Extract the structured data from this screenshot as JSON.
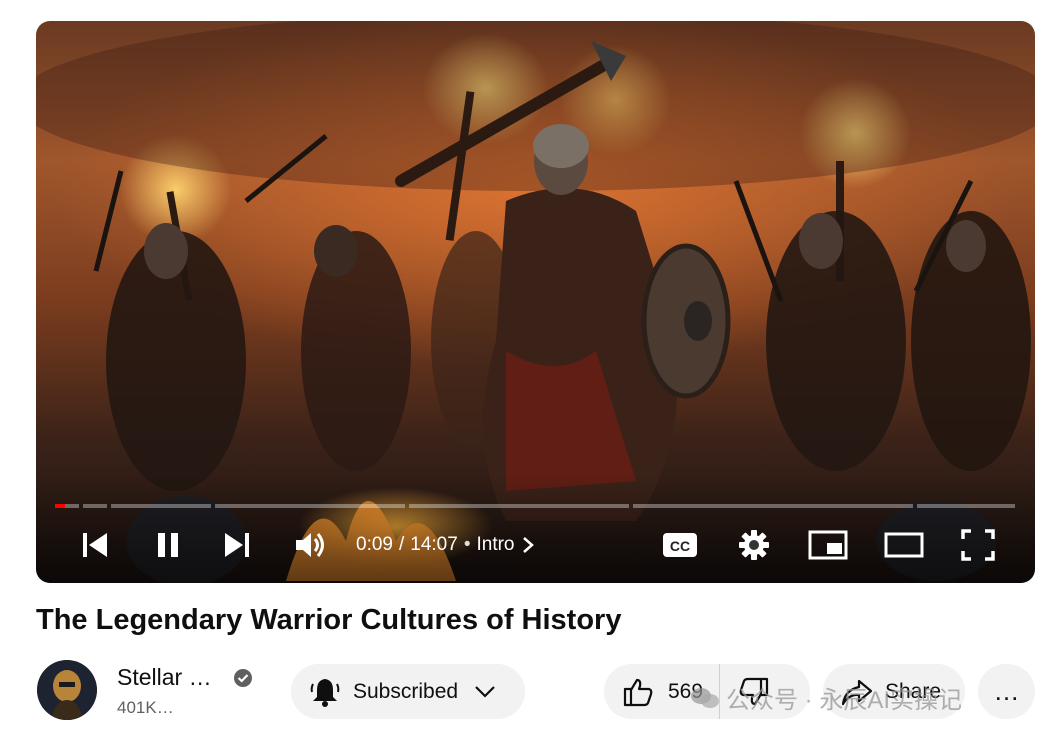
{
  "video": {
    "current_time": "0:09",
    "separator": "/",
    "duration": "14:07",
    "chapter_dot": "•",
    "chapter": "Intro",
    "progress_fraction": 0.0106
  },
  "title": "The Legendary Warrior Cultures of History",
  "channel": {
    "name": "Stellar …",
    "subscribers": "401K…"
  },
  "actions": {
    "subscribed_label": "Subscribed",
    "like_count": "569",
    "share_label": "Share",
    "more_label": "…"
  },
  "watermark": "公众号 · 永辰AI实操记",
  "colors": {
    "progress_played": "#ff0000",
    "pill_bg": "#f2f2f2",
    "title_text": "#0f0f0f",
    "secondary_text": "#606060"
  },
  "icons": [
    "previous-icon",
    "pause-icon",
    "next-icon",
    "volume-icon",
    "chevron-right-icon",
    "cc-icon",
    "settings-icon",
    "miniplayer-icon",
    "theater-icon",
    "fullscreen-icon",
    "verified-icon",
    "bell-icon",
    "chevron-down-icon",
    "thumbs-up-icon",
    "thumbs-down-icon",
    "share-icon"
  ]
}
